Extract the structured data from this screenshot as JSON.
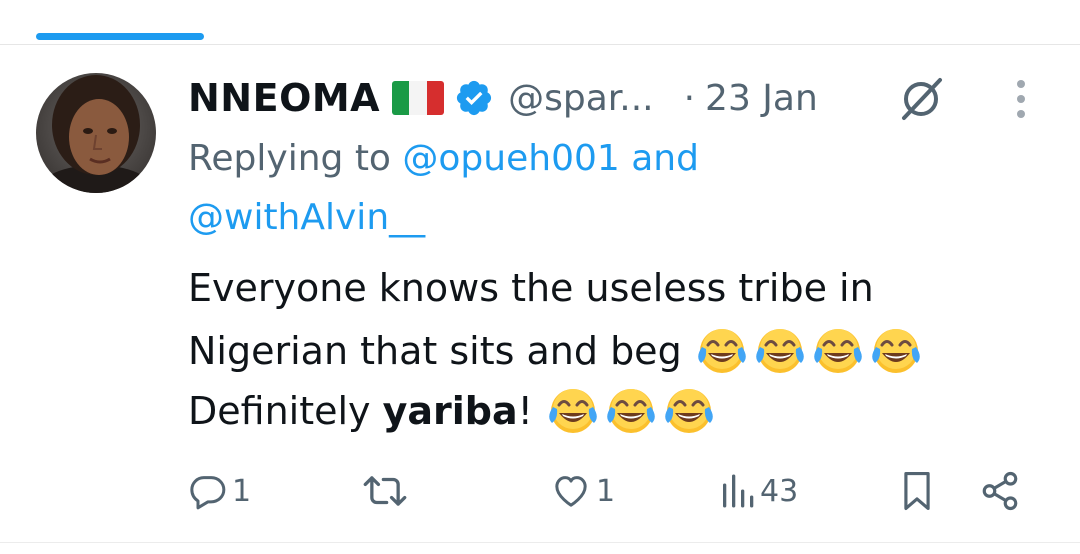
{
  "tweet": {
    "author": {
      "name": "NNEOMA",
      "handle": "@spar...",
      "flag_icon": "italy-flag-icon",
      "verified_icon": "verified-badge-icon",
      "verified_color": "#1d9bf0"
    },
    "date_separator": "·",
    "date": "23 Jan",
    "reply": {
      "prefix": "Replying to ",
      "mention1": "@opueh001",
      "conjunction": " and",
      "mention2": "@withAlvin__"
    },
    "body": {
      "line1": "Everyone knows the useless tribe in",
      "line2": "Nigerian that sits and beg",
      "line3_prefix": "Definitely ",
      "line3_bold": "yariba",
      "line3_suffix": "!",
      "emoji_name": "face-with-tears-of-joy"
    },
    "actions": {
      "replies": "1",
      "retweets": "",
      "likes": "1",
      "views": "43"
    }
  },
  "colors": {
    "accent": "#1d9bf0",
    "secondary_text": "#536471",
    "primary_text": "#0f1419"
  }
}
